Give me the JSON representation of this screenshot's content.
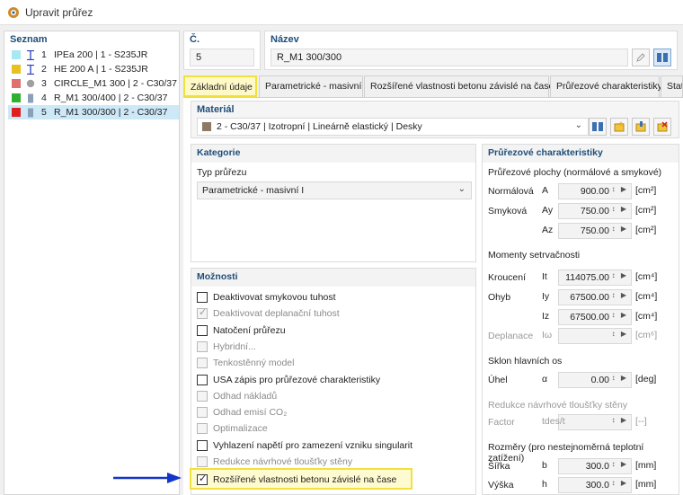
{
  "window": {
    "title": "Upravit průřez"
  },
  "list": {
    "header": "Seznam",
    "items": [
      {
        "num": "1",
        "label": "IPEa 200 | 1 - S235JR",
        "color": "#a8e8f0",
        "shape": "I"
      },
      {
        "num": "2",
        "label": "HE 200 A | 1 - S235JR",
        "color": "#e8c020",
        "shape": "I"
      },
      {
        "num": "3",
        "label": "CIRCLE_M1 300 | 2 - C30/37",
        "color": "#e07070",
        "shape": "circle"
      },
      {
        "num": "4",
        "label": "R_M1 300/400 | 2 - C30/37",
        "color": "#30b030",
        "shape": "rect"
      },
      {
        "num": "5",
        "label": "R_M1 300/300 | 2 - C30/37",
        "color": "#e02020",
        "shape": "rect"
      }
    ]
  },
  "header": {
    "num_label": "Č.",
    "num_value": "5",
    "name_label": "Název",
    "name_value": "R_M1 300/300"
  },
  "tabs": [
    "Základní údaje",
    "Parametrické - masivní I",
    "Rozšířené vlastnosti betonu závislé na čase",
    "Průřezové charakteristiky",
    "Stat"
  ],
  "material": {
    "label": "Materiál",
    "value": "2 - C30/37 | Izotropní | Lineárně elastický | Desky",
    "swatch": "#8c7a64"
  },
  "category": {
    "title": "Kategorie",
    "type_label": "Typ průřezu",
    "type_value": "Parametrické - masivní I"
  },
  "options": {
    "title": "Možnosti",
    "items": [
      {
        "label": "Deaktivovat smykovou tuhost",
        "checked": false,
        "disabled": false
      },
      {
        "label": "Deaktivovat deplanační tuhost",
        "checked": true,
        "disabled": true
      },
      {
        "label": "Natočení průřezu",
        "checked": false,
        "disabled": false
      },
      {
        "label": "Hybridní...",
        "checked": false,
        "disabled": true
      },
      {
        "label": "Tenkostěnný model",
        "checked": false,
        "disabled": true
      },
      {
        "label": "USA zápis pro průřezové charakteristiky",
        "checked": false,
        "disabled": false
      },
      {
        "label": "Odhad nákladů",
        "checked": false,
        "disabled": true
      },
      {
        "label": "Odhad emisí CO₂",
        "checked": false,
        "disabled": true
      },
      {
        "label": "Optimalizace",
        "checked": false,
        "disabled": true
      },
      {
        "label": "Vyhlazení napětí pro zamezení vzniku singularit",
        "checked": false,
        "disabled": false
      },
      {
        "label": "Redukce návrhové tloušťky stěny",
        "checked": false,
        "disabled": true
      },
      {
        "label": "Rozšířené vlastnosti betonu závislé na čase",
        "checked": true,
        "disabled": false
      }
    ]
  },
  "props": {
    "title": "Průřezové charakteristiky",
    "areas_title": "Průřezové plochy (normálové a smykové)",
    "normal_label": "Normálová",
    "shear_label": "Smyková",
    "A": {
      "sym": "A",
      "value": "900.00",
      "unit": "[cm²]"
    },
    "Ay": {
      "sym": "Ay",
      "value": "750.00",
      "unit": "[cm²]"
    },
    "Az": {
      "sym": "Az",
      "value": "750.00",
      "unit": "[cm²]"
    },
    "moments_title": "Momenty setrvačnosti",
    "torsion_label": "Kroucení",
    "bending_label": "Ohyb",
    "warping_label": "Deplanace",
    "It": {
      "sym": "It",
      "value": "114075.00",
      "unit": "[cm⁴]"
    },
    "Iy": {
      "sym": "Iy",
      "value": "67500.00",
      "unit": "[cm⁴]"
    },
    "Iz": {
      "sym": "Iz",
      "value": "67500.00",
      "unit": "[cm⁴]"
    },
    "Iw": {
      "sym": "Iω",
      "value": "",
      "unit": "[cm⁶]"
    },
    "axes_title": "Sklon hlavních os",
    "angle_label": "Úhel",
    "alpha": {
      "sym": "α",
      "value": "0.00",
      "unit": "[deg]"
    },
    "reduction_title": "Redukce návrhové tloušťky stěny",
    "factor_label": "Factor",
    "factor": {
      "sym": "tdes/t",
      "value": "",
      "unit": "[--]"
    },
    "dims_title": "Rozměry (pro nestejnoměrná teplotní zatížení)",
    "width_label": "Šířka",
    "height_label": "Výška",
    "b": {
      "sym": "b",
      "value": "300.0",
      "unit": "[mm]"
    },
    "h": {
      "sym": "h",
      "value": "300.0",
      "unit": "[mm]"
    }
  }
}
